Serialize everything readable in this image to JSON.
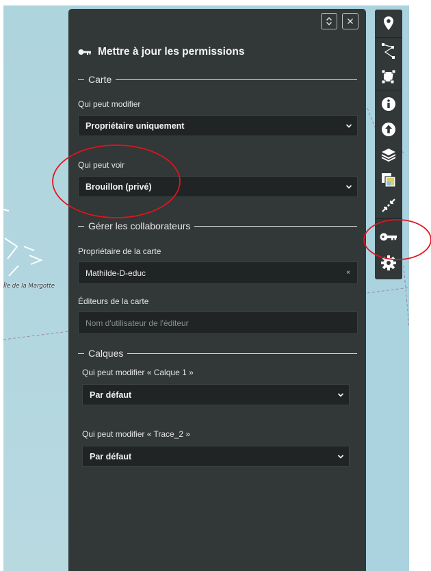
{
  "map": {
    "place_label": "Île de la Margotte"
  },
  "panel": {
    "title": "Mettre à jour les permissions",
    "title_icon": "key-icon",
    "collapse_icon": "collapse-expand-icon",
    "close_icon": "close-icon",
    "map_section": {
      "legend": "Carte",
      "edit_label": "Qui peut modifier",
      "edit_value": "Propriétaire uniquement",
      "view_label": "Qui peut voir",
      "view_value": "Brouillon (privé)"
    },
    "collab_section": {
      "legend": "Gérer les collaborateurs",
      "owner_label": "Propriétaire de la carte",
      "owner_value": "Mathilde-D-educ",
      "owner_clear": "×",
      "editors_label": "Éditeurs de la carte",
      "editors_placeholder": "Nom d'utilisateur de l'éditeur"
    },
    "layers_section": {
      "legend": "Calques",
      "layers": [
        {
          "label": "Qui peut modifier « Calque 1 »",
          "value": "Par défaut"
        },
        {
          "label": "Qui peut modifier « Trace_2 »",
          "value": "Par défaut"
        }
      ]
    }
  },
  "toolbar": {
    "buttons": [
      {
        "name": "marker-icon"
      },
      {
        "name": "draw-line-icon"
      },
      {
        "name": "draw-polygon-icon"
      },
      {
        "name": "info-icon"
      },
      {
        "name": "import-icon"
      },
      {
        "name": "layers-icon"
      },
      {
        "name": "tilelayer-icon"
      },
      {
        "name": "center-view-icon"
      },
      {
        "name": "key-icon"
      },
      {
        "name": "settings-icon"
      }
    ]
  },
  "colors": {
    "panel_bg": "#323737",
    "input_bg": "#202424",
    "map_water": "#aad3df",
    "annotation_red": "#e0141e"
  }
}
